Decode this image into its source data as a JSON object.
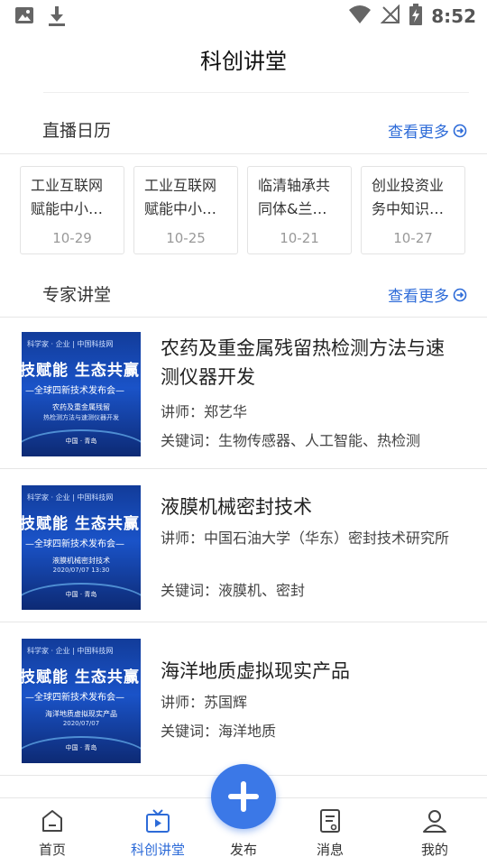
{
  "status_bar": {
    "time": "8:52",
    "left_icons": [
      "image-icon",
      "download-icon"
    ],
    "right_icons": [
      "wifi-icon",
      "no-signal-icon",
      "battery-charging-icon"
    ]
  },
  "header": {
    "title": "科创讲堂"
  },
  "live_calendar": {
    "title": "直播日历",
    "more": "查看更多",
    "items": [
      {
        "title": "工业互联网赋能中小…",
        "date": "10-29"
      },
      {
        "title": "工业互联网赋能中小…",
        "date": "10-25"
      },
      {
        "title": "临清轴承共同体&兰…",
        "date": "10-21"
      },
      {
        "title": "创业投资业务中知识…",
        "date": "10-27"
      }
    ]
  },
  "expert_lecture": {
    "title": "专家讲堂",
    "more": "查看更多",
    "items": [
      {
        "title": "农药及重金属残留热检测方法与速测仪器开发",
        "lecturer": "讲师：郑艺华",
        "keywords": "关键词：生物传感器、人工智能、热检测",
        "thumb": {
          "top": "科学家 · 企业 | 中国科技网",
          "big": "技赋能 生态共赢",
          "sub": "—全球四新技术发布会—",
          "line1": "农药及重金属残留",
          "line2": "热检测方法与速测仪器开发",
          "foot": "中国 · 青岛"
        }
      },
      {
        "title": "液膜机械密封技术",
        "lecturer": "讲师：中国石油大学（华东）密封技术研究所",
        "keywords": "关键词：液膜机、密封",
        "thumb": {
          "top": "科学家 · 企业 | 中国科技网",
          "big": "技赋能 生态共赢",
          "sub": "—全球四新技术发布会—",
          "line1": "液膜机械密封技术",
          "line2": "2020/07/07 13:30",
          "foot": "中国 · 青岛"
        }
      },
      {
        "title": "海洋地质虚拟现实产品",
        "lecturer": "讲师：苏国辉",
        "keywords": "关键词：海洋地质",
        "thumb": {
          "top": "科学家 · 企业 | 中国科技网",
          "big": "技赋能 生态共赢",
          "sub": "—全球四新技术发布会—",
          "line1": "海洋地质虚拟现实产品",
          "line2": "2020/07/07",
          "foot": "中国 · 青岛"
        }
      }
    ]
  },
  "fab": {
    "icon": "plus-icon",
    "color": "#3b78e7"
  },
  "tab_bar": {
    "tabs": [
      {
        "label": "首页",
        "icon": "home-icon"
      },
      {
        "label": "科创讲堂",
        "icon": "tv-icon",
        "active": true
      },
      {
        "label": "发布",
        "icon": "plus-icon"
      },
      {
        "label": "消息",
        "icon": "message-icon"
      },
      {
        "label": "我的",
        "icon": "user-icon"
      }
    ]
  },
  "colors": {
    "accent": "#2d6bd8",
    "divider": "#e6e6e6"
  }
}
